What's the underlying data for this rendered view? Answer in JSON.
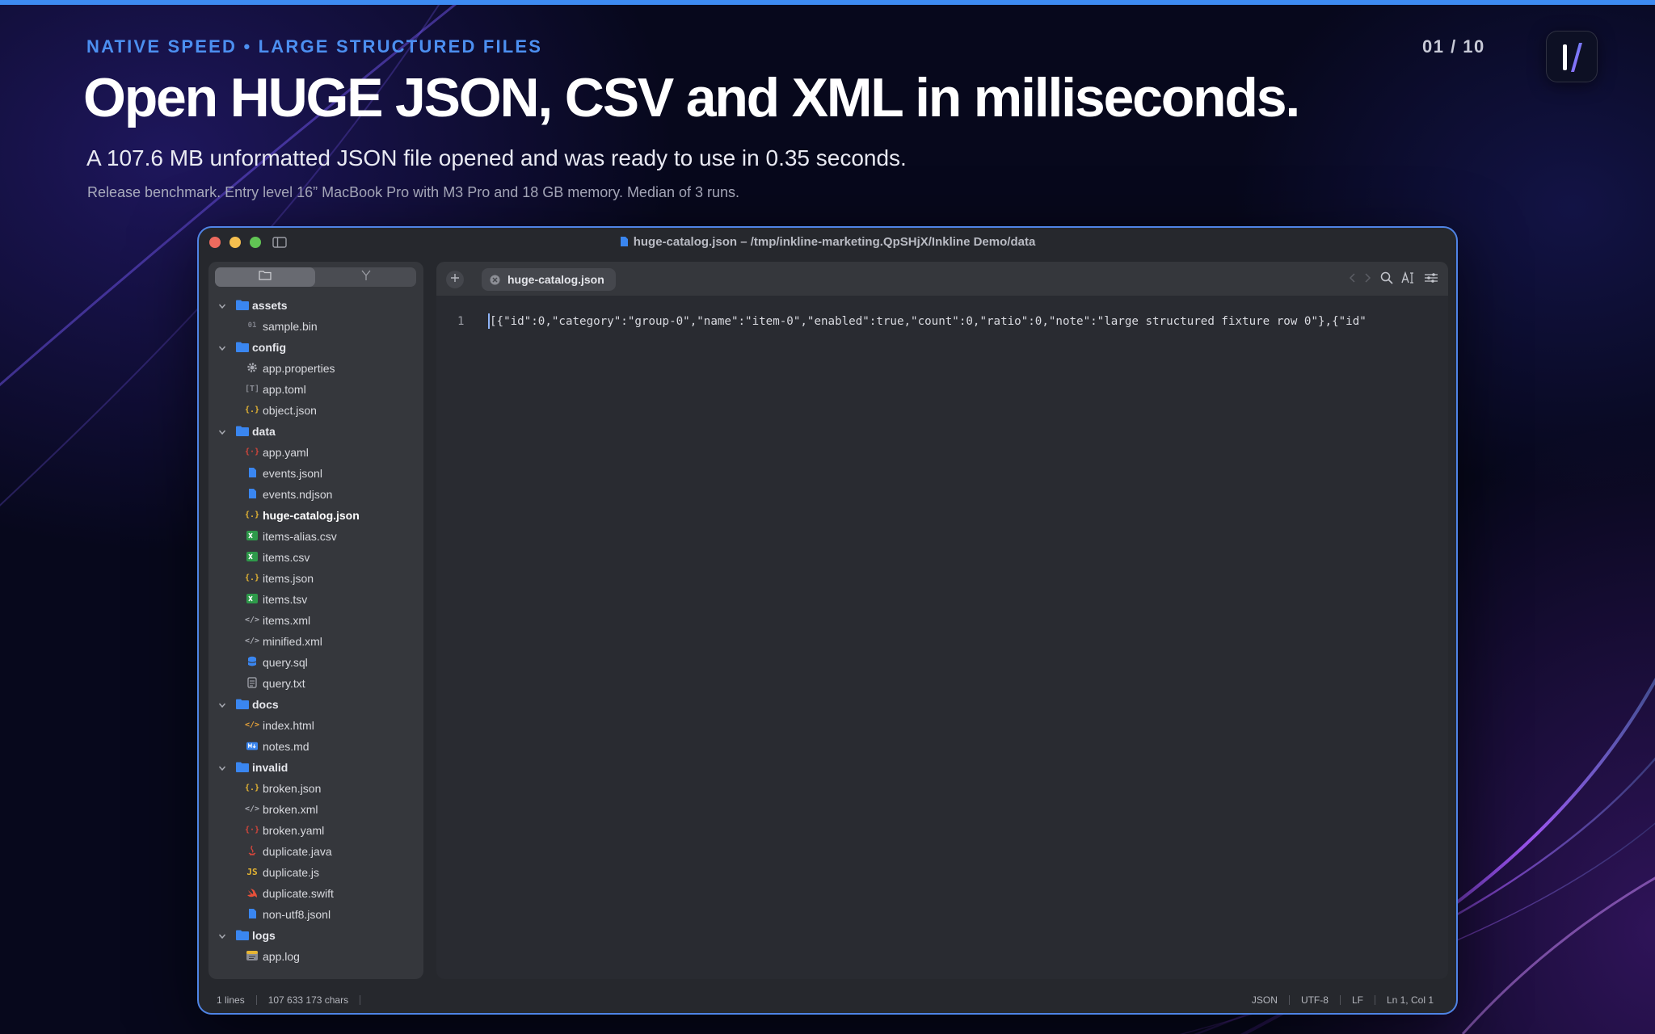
{
  "slide": {
    "eyebrow": "NATIVE SPEED • LARGE STRUCTURED FILES",
    "counter": "01 / 10",
    "headline": "Open HUGE JSON, CSV and XML in milliseconds.",
    "subhead": "A 107.6 MB unformatted JSON file opened and was ready to use in 0.35 seconds.",
    "footnote": "Release benchmark. Entry level 16” MacBook Pro with M3 Pro and 18 GB memory. Median of 3 runs.",
    "logo_icon": "inkline-logo-icon"
  },
  "window": {
    "title": "huge-catalog.json – /tmp/inkline-marketing.QpSHjX/Inkline Demo/data"
  },
  "sidebar": {
    "tabs": [
      "files",
      "outline"
    ],
    "tree": [
      {
        "type": "folder",
        "label": "assets"
      },
      {
        "type": "file",
        "label": "sample.bin",
        "icon": "binary-icon"
      },
      {
        "type": "folder",
        "label": "config"
      },
      {
        "type": "file",
        "label": "app.properties",
        "icon": "gear-icon"
      },
      {
        "type": "file",
        "label": "app.toml",
        "icon": "toml-icon"
      },
      {
        "type": "file",
        "label": "object.json",
        "icon": "json-icon"
      },
      {
        "type": "folder",
        "label": "data"
      },
      {
        "type": "file",
        "label": "app.yaml",
        "icon": "yaml-icon"
      },
      {
        "type": "file",
        "label": "events.jsonl",
        "icon": "document-icon"
      },
      {
        "type": "file",
        "label": "events.ndjson",
        "icon": "document-icon"
      },
      {
        "type": "file",
        "label": "huge-catalog.json",
        "icon": "json-icon",
        "active": true
      },
      {
        "type": "file",
        "label": "items-alias.csv",
        "icon": "spreadsheet-icon"
      },
      {
        "type": "file",
        "label": "items.csv",
        "icon": "spreadsheet-icon"
      },
      {
        "type": "file",
        "label": "items.json",
        "icon": "json-icon"
      },
      {
        "type": "file",
        "label": "items.tsv",
        "icon": "spreadsheet-icon"
      },
      {
        "type": "file",
        "label": "items.xml",
        "icon": "xml-icon"
      },
      {
        "type": "file",
        "label": "minified.xml",
        "icon": "xml-icon"
      },
      {
        "type": "file",
        "label": "query.sql",
        "icon": "database-icon"
      },
      {
        "type": "file",
        "label": "query.txt",
        "icon": "text-icon"
      },
      {
        "type": "folder",
        "label": "docs"
      },
      {
        "type": "file",
        "label": "index.html",
        "icon": "html-icon"
      },
      {
        "type": "file",
        "label": "notes.md",
        "icon": "markdown-icon"
      },
      {
        "type": "folder",
        "label": "invalid"
      },
      {
        "type": "file",
        "label": "broken.json",
        "icon": "json-icon"
      },
      {
        "type": "file",
        "label": "broken.xml",
        "icon": "xml-icon"
      },
      {
        "type": "file",
        "label": "broken.yaml",
        "icon": "yaml-icon"
      },
      {
        "type": "file",
        "label": "duplicate.java",
        "icon": "java-icon"
      },
      {
        "type": "file",
        "label": "duplicate.js",
        "icon": "javascript-icon"
      },
      {
        "type": "file",
        "label": "duplicate.swift",
        "icon": "swift-icon"
      },
      {
        "type": "file",
        "label": "non-utf8.jsonl",
        "icon": "document-icon"
      },
      {
        "type": "folder",
        "label": "logs"
      },
      {
        "type": "file",
        "label": "app.log",
        "icon": "log-icon"
      }
    ]
  },
  "editor": {
    "tab_label": "huge-catalog.json",
    "line_number": "1",
    "line_text": "[{\"id\":0,\"category\":\"group-0\",\"name\":\"item-0\",\"enabled\":true,\"count\":0,\"ratio\":0,\"note\":\"large structured fixture row 0\"},{\"id\"",
    "toolbar": [
      "back-icon",
      "forward-icon",
      "search-icon",
      "text-format-icon",
      "settings-sliders-icon"
    ]
  },
  "status": {
    "lines": "1 lines",
    "chars": "107 633 173 chars",
    "language": "JSON",
    "encoding": "UTF-8",
    "line_ending": "LF",
    "position": "Ln 1, Col 1"
  },
  "colors": {
    "accent": "#3d8bf2",
    "eyebrow": "#4c8ff0",
    "window_border": "#4f84e6",
    "folder": "#3a86f0",
    "json": "#e6b533",
    "yaml": "#d4463b",
    "spreadsheet": "#2e9a4a"
  }
}
